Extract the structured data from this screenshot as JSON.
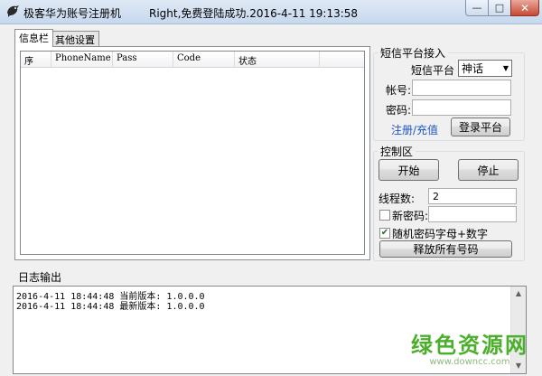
{
  "window": {
    "title": "极客华为账号注册机",
    "status": "Right,免费登陆成功.2016-4-11 19:13:58",
    "minimize_glyph": "—",
    "maximize_glyph": "□",
    "close_glyph": "✕"
  },
  "tabs": [
    {
      "label": "信息栏",
      "active": true
    },
    {
      "label": "其他设置",
      "active": false
    }
  ],
  "list": {
    "columns": [
      "序",
      "PhoneName",
      "Pass",
      "Code",
      "状态"
    ],
    "rows": []
  },
  "sms": {
    "legend": "短信平台接入",
    "platform_label": "短信平台",
    "platform_value": "神话",
    "account_label": "帐号:",
    "account_value": "",
    "password_label": "密码:",
    "password_value": "",
    "register_link": "注册/充值",
    "login_button": "登录平台"
  },
  "control": {
    "legend": "控制区",
    "start_button": "开始",
    "stop_button": "停止",
    "threads_label": "线程数:",
    "threads_value": "2",
    "new_password_label": "新密码:",
    "new_password_checked": false,
    "new_password_value": "",
    "random_password_label": "随机密码字母+数字",
    "random_password_checked": true,
    "release_button": "释放所有号码"
  },
  "log": {
    "legend": "日志输出",
    "lines": [
      "2016-4-11 18:44:48 当前版本: 1.0.0.0",
      "2016-4-11 18:44:48 最新版本: 1.0.0.0"
    ]
  },
  "watermark": {
    "main": "绿色资源网",
    "sub": "www.downcc.com"
  },
  "colors": {
    "link": "#1a55c8",
    "watermark": "#4caf2c",
    "close_button": "#c74a33"
  }
}
